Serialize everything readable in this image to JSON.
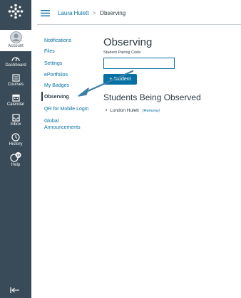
{
  "global_nav": {
    "items": [
      {
        "label": "Account",
        "icon": "avatar-icon"
      },
      {
        "label": "Dashboard",
        "icon": "dashboard-icon"
      },
      {
        "label": "Courses",
        "icon": "courses-icon"
      },
      {
        "label": "Calendar",
        "icon": "calendar-icon"
      },
      {
        "label": "Inbox",
        "icon": "inbox-icon"
      },
      {
        "label": "History",
        "icon": "clock-icon"
      },
      {
        "label": "Help",
        "icon": "help-icon",
        "badge": "10"
      }
    ],
    "collapse_icon": "collapse-arrow-icon"
  },
  "breadcrumb": {
    "link": "Laura Hulett",
    "separator": ">",
    "current": "Observing"
  },
  "section_nav": {
    "items": [
      {
        "label": "Notifications"
      },
      {
        "label": "Files"
      },
      {
        "label": "Settings"
      },
      {
        "label": "ePortfolios"
      },
      {
        "label": "My Badges"
      },
      {
        "label": "Observing",
        "active": true
      },
      {
        "label": "QR for Mobile Login"
      },
      {
        "label": "Global"
      },
      {
        "label": "Announcements"
      }
    ]
  },
  "main": {
    "title": "Observing",
    "pairing_label": "Student Pairing Code",
    "pairing_value": "",
    "add_button": "+ Student",
    "observed_heading": "Students Being Observed",
    "students": [
      {
        "name": "London Hulett",
        "action": "(Remove)"
      }
    ]
  },
  "colors": {
    "nav_bg": "#394b58",
    "link": "#0770a3",
    "text": "#2d3b45",
    "annotation_arrow": "#3a7fa8"
  }
}
